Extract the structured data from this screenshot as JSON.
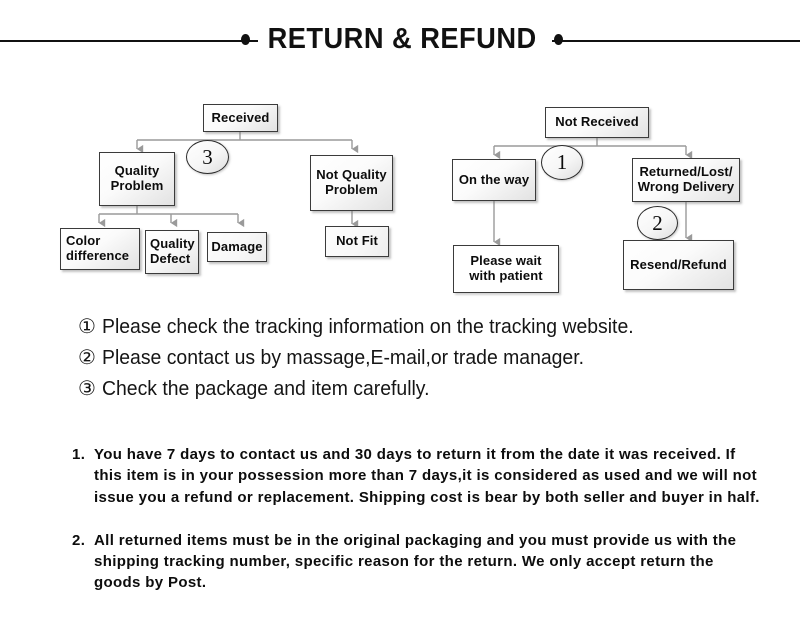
{
  "header": {
    "title": "RETURN & REFUND",
    "left_dot": "bullet-dot",
    "right_dot": "bullet-dot"
  },
  "flowchart": {
    "left_tree": {
      "root": "Received",
      "badge": "3",
      "branches": [
        {
          "label": "Quality  Problem",
          "children": [
            "Color difference",
            "Quality Defect",
            "Damage"
          ]
        },
        {
          "label": "Not Quality Problem",
          "children": [
            "Not Fit"
          ]
        }
      ]
    },
    "right_tree": {
      "root": "Not  Received",
      "badge_top": "1",
      "badge_bottom": "2",
      "branches": [
        {
          "label": "On the way",
          "children": [
            "Please wait with patient"
          ]
        },
        {
          "label": "Returned/Lost/ Wrong Delivery",
          "children": [
            "Resend/Refund"
          ]
        }
      ]
    },
    "nodes": {
      "received": "Received",
      "quality_problem": "Quality\nProblem",
      "quality_problem_l1": "Quality",
      "quality_problem_l2": "Problem",
      "not_quality_problem_l1": "Not Quality",
      "not_quality_problem_l2": "Problem",
      "color_difference_l1": "Color",
      "color_difference_l2": "difference",
      "quality_defect_l1": "Quality",
      "quality_defect_l2": "Defect",
      "damage": "Damage",
      "not_fit": "Not Fit",
      "not_received": "Not  Received",
      "on_the_way": "On the way",
      "please_wait_l1": "Please wait",
      "please_wait_l2": "with patient",
      "returned_lost_l1": "Returned/Lost/",
      "returned_lost_l2": "Wrong Delivery",
      "resend_refund": "Resend/Refund"
    },
    "badges": {
      "three": "3",
      "one": "1",
      "two": "2"
    }
  },
  "notes": [
    {
      "num": "①",
      "text": "Please check the tracking information on the tracking website."
    },
    {
      "num": "②",
      "text": "Please contact us by  massage,E-mail,or trade manager."
    },
    {
      "num": "③",
      "text": "Check the package and item carefully."
    }
  ],
  "terms": [
    {
      "num": "1.",
      "text": "You have 7 days to contact us and 30 days to return it from the date it was received. If this item is in your possession more than 7 days,it is considered as used and we will not issue you a refund or replacement. Shipping cost is bear by both seller and buyer in half."
    },
    {
      "num": "2.",
      "text": "All returned items must be in the original packaging and you must provide us with the shipping tracking number, specific reason for the return. We only accept return the goods by Post."
    }
  ],
  "colors": {
    "rule": "#111111",
    "text": "#111111",
    "node_border": "#3b3b3b",
    "connector": "#9a9a9a",
    "background": "#ffffff"
  }
}
